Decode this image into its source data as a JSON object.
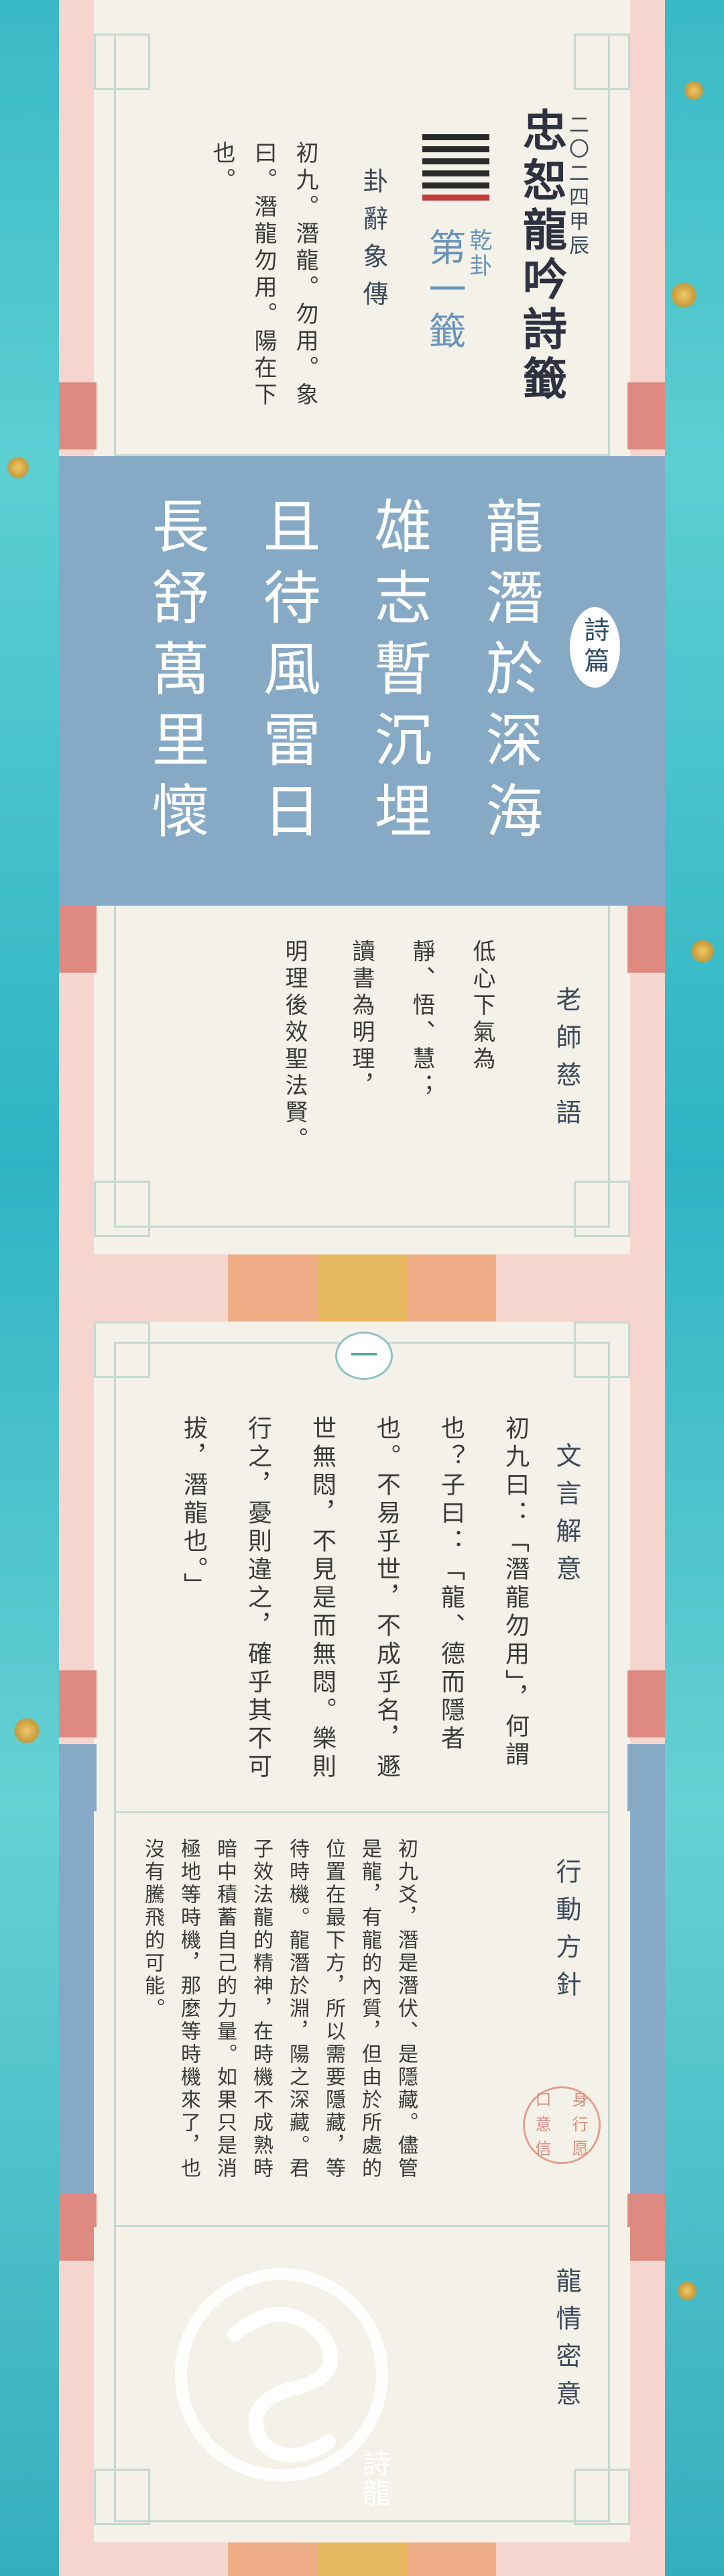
{
  "header": {
    "year": "二〇二四甲辰",
    "title": "忠恕龍吟詩籤",
    "hexagram_name": "乾卦",
    "lot_number": "第一籤",
    "section_label": "卦辭象傳",
    "text": "初九。潛龍。勿用。象曰。潛龍勿用。陽在下也。"
  },
  "poem": {
    "label": "詩篇",
    "lines": [
      "龍潛於深海",
      "雄志暫沉埋",
      "且待風雷日",
      "長舒萬里懷"
    ]
  },
  "teacher": {
    "label": "老師慈語",
    "lines": [
      "低心下氣為",
      "靜、悟、慧；",
      "讀書為明理，",
      "明理後效聖法賢。"
    ]
  },
  "wenyan": {
    "badge": "一",
    "label": "文言解意",
    "text": "初九曰：「潛龍勿用」，何謂也？子曰：「龍、德而隱者也。不易乎世，不成乎名，遯世無悶，不見是而無悶。樂則行之，憂則違之，確乎其不可拔，潛龍也。」"
  },
  "action": {
    "label": "行動方針",
    "seal": [
      "口",
      "身",
      "意",
      "行",
      "信",
      "愿"
    ],
    "text": "初九爻，潛是潛伏、是隱藏。儘管是龍，有龍的內質，但由於所處的位置在最下方，所以需要隱藏，等待時機。龍潛於淵，陽之深藏。君子效法龍的精神，在時機不成熟時暗中積蓄自己的力量。如果只是消極地等時機，那麼等時機來了，也沒有騰飛的可能。"
  },
  "love": {
    "label": "龍情密意",
    "watermark": "詩龍"
  },
  "colors": {
    "teal": "#39b9c6",
    "pink": "#f6d5cf",
    "cream": "#f3f1e8",
    "blue_band": "#86aac6",
    "coral": "#df8a80",
    "gold": "#e6b85f",
    "crown": "#a9495a"
  }
}
